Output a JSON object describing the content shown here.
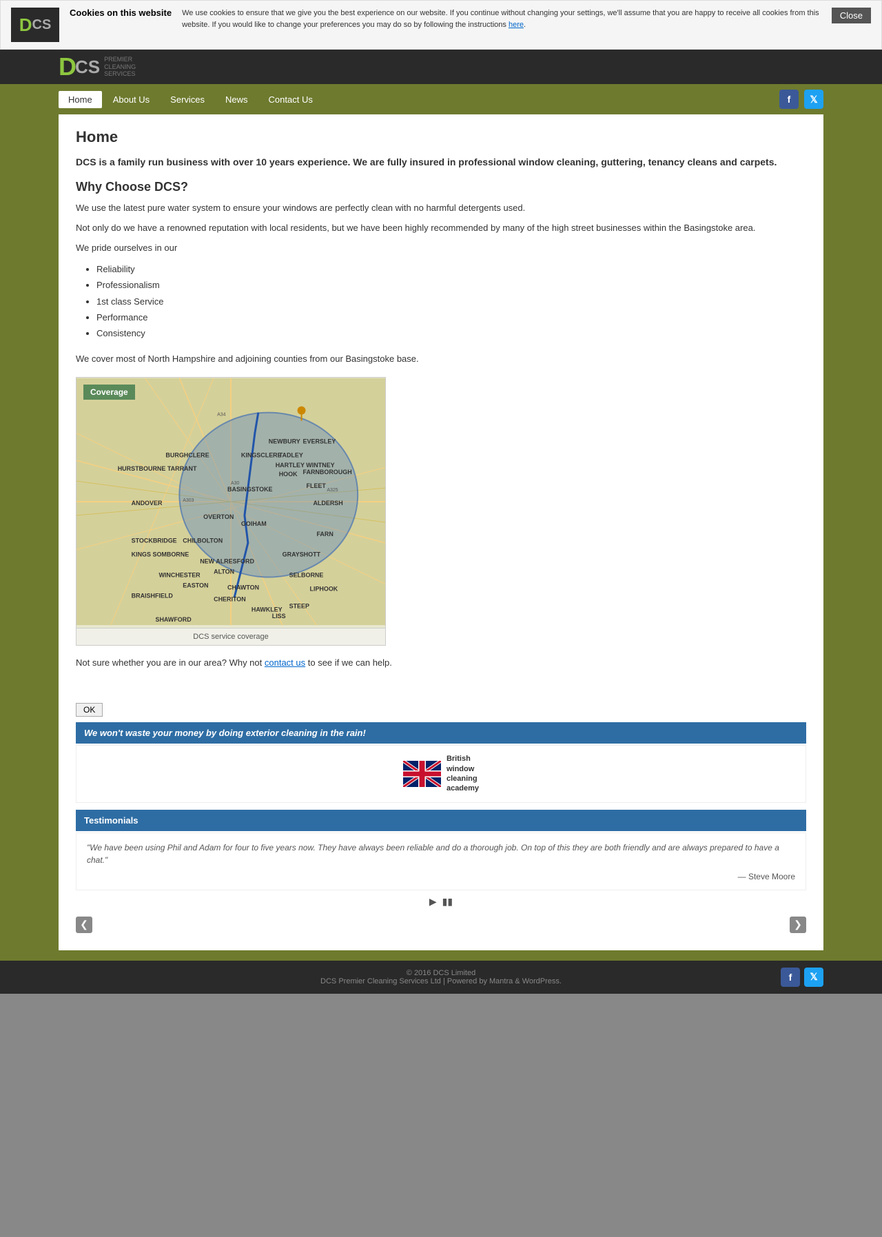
{
  "cookie": {
    "logo_text": "DCS",
    "title": "Cookies on this website",
    "message": "We use cookies to ensure that we give you the best experience on our website. If you continue without changing your settings, we'll assume that you are happy to receive all cookies from this website. If you would like to change your preferences you may do so by following the instructions ",
    "link_text": "here",
    "close_label": "Close"
  },
  "nav": {
    "home_label": "Home",
    "about_label": "About Us",
    "services_label": "Services",
    "news_label": "News",
    "contact_label": "Contact Us"
  },
  "main": {
    "page_title": "Home",
    "intro": "DCS is a family run business with over 10 years experience. We are fully insured in professional window cleaning, guttering, tenancy cleans and carpets.",
    "why_title": "Why Choose DCS?",
    "para1": "We use the latest pure water system to ensure your windows are perfectly clean with no harmful detergents used.",
    "para2": "Not only do we have a renowned reputation with local residents, but we have been highly recommended by many of the high street businesses within the Basingstoke area.",
    "pride_intro": "We pride ourselves in our",
    "list_items": [
      "Reliability",
      "Professionalism",
      "1st class Service",
      "Performance",
      "Consistency"
    ],
    "coverage_text": "We cover most of North Hampshire and adjoining counties from our Basingstoke base.",
    "map_badge": "Coverage",
    "map_caption": "DCS service coverage",
    "contact_question": "Not sure whether you are in our area? Why not ",
    "contact_link": "contact us",
    "contact_end": " to see if we can help.",
    "ok_label": "OK"
  },
  "sidebar": {
    "rain_warning": "We won't waste your money by doing exterior cleaning in the rain!",
    "bwa_line1": "British",
    "bwa_line2": "window",
    "bwa_line3": "cleaning",
    "bwa_line4": "academy",
    "testimonials_title": "Testimonials",
    "testimonial_quote": "\"We have been using Phil and Adam for four to five years now. They have always been reliable and do a thorough job. On top of this they are both friendly and are always prepared to have a chat.\"",
    "testimonial_author": "— Steve Moore"
  },
  "footer": {
    "copyright": "© 2016 DCS Limited",
    "credits": "DCS Premier Cleaning Services Ltd | Powered by Mantra & WordPress."
  }
}
